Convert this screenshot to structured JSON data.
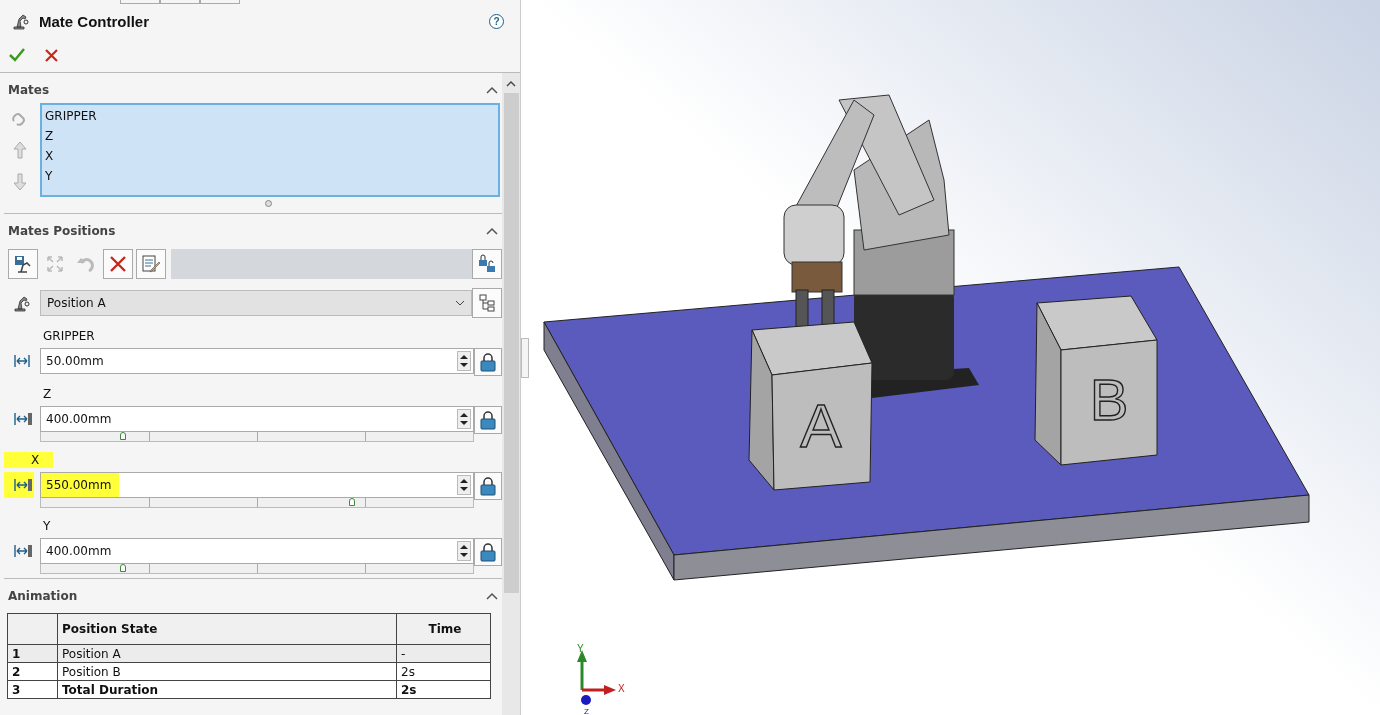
{
  "panel": {
    "title": "Mate Controller",
    "help": "?"
  },
  "mates": {
    "header": "Mates",
    "items": [
      "GRIPPER",
      "Z",
      "X",
      "Y"
    ]
  },
  "positions": {
    "header": "Mates Positions",
    "dropdown": "Position A",
    "fields": [
      {
        "label": "GRIPPER",
        "value": "50.00mm",
        "highlighted": false
      },
      {
        "label": "Z",
        "value": "400.00mm",
        "highlighted": false,
        "level": 0.19
      },
      {
        "label": "X",
        "value": "550.00mm",
        "highlighted": true,
        "level": 0.72
      },
      {
        "label": "Y",
        "value": "400.00mm",
        "highlighted": false,
        "level": 0.19
      }
    ]
  },
  "animation": {
    "header": "Animation",
    "columns": [
      "Position State",
      "Time"
    ],
    "rows": [
      {
        "index": "1",
        "state": "Position A",
        "time": "-",
        "kind": "position",
        "selected": true
      },
      {
        "index": "2",
        "state": "Position B",
        "time": "2s",
        "kind": "position",
        "selected": false
      },
      {
        "index": "3",
        "state": "Total Duration",
        "time": "2s",
        "kind": "total",
        "selected": false
      }
    ]
  },
  "viewport": {
    "blocks": [
      "A",
      "B"
    ],
    "triad": {
      "x": "X",
      "y": "Y",
      "z": "Z"
    }
  }
}
